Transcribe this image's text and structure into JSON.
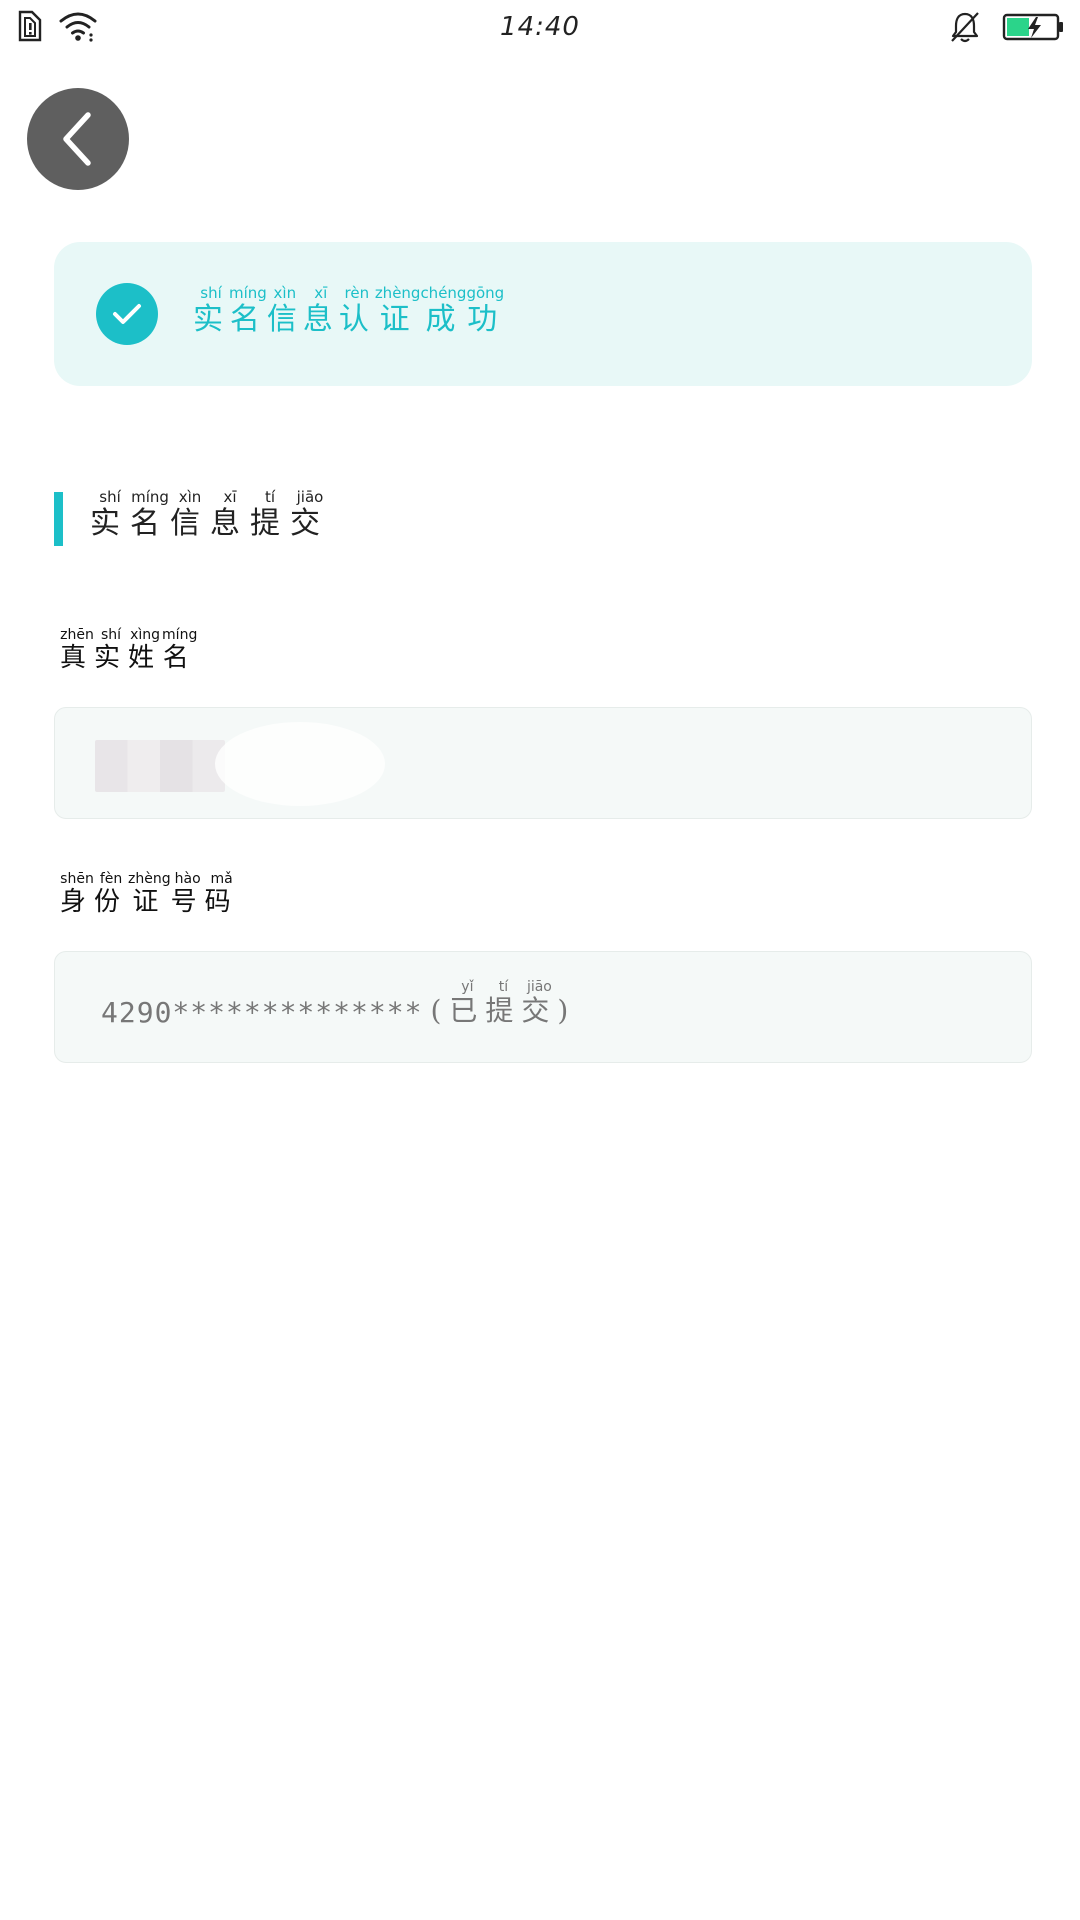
{
  "status_bar": {
    "time": "14:40",
    "icons": [
      "sim-icon",
      "wifi-icon",
      "bell-muted-icon",
      "battery-charging-icon"
    ]
  },
  "back_button": {
    "icon": "chevron-left-icon"
  },
  "banner": {
    "icon": "check-icon",
    "text": [
      {
        "hanzi": "实",
        "pinyin": "shí"
      },
      {
        "hanzi": "名",
        "pinyin": "míng"
      },
      {
        "hanzi": "信",
        "pinyin": "xìn"
      },
      {
        "hanzi": "息",
        "pinyin": "xī"
      },
      {
        "hanzi": "认",
        "pinyin": "rèn"
      },
      {
        "hanzi": "证",
        "pinyin": "zhèng"
      },
      {
        "hanzi": "成",
        "pinyin": "chéng"
      },
      {
        "hanzi": "功",
        "pinyin": "gōng"
      }
    ]
  },
  "section": {
    "title": [
      {
        "hanzi": "实",
        "pinyin": "shí"
      },
      {
        "hanzi": "名",
        "pinyin": "míng"
      },
      {
        "hanzi": "信",
        "pinyin": "xìn"
      },
      {
        "hanzi": "息",
        "pinyin": "xī"
      },
      {
        "hanzi": "提",
        "pinyin": "tí"
      },
      {
        "hanzi": "交",
        "pinyin": "jiāo"
      }
    ]
  },
  "fields": {
    "name_label": [
      {
        "hanzi": "真",
        "pinyin": "zhēn"
      },
      {
        "hanzi": "实",
        "pinyin": "shí"
      },
      {
        "hanzi": "姓",
        "pinyin": "xìng"
      },
      {
        "hanzi": "名",
        "pinyin": "míng"
      }
    ],
    "id_label": [
      {
        "hanzi": "身",
        "pinyin": "shēn"
      },
      {
        "hanzi": "份",
        "pinyin": "fèn"
      },
      {
        "hanzi": "证",
        "pinyin": "zhèng"
      },
      {
        "hanzi": "号",
        "pinyin": "hào"
      },
      {
        "hanzi": "码",
        "pinyin": "mǎ"
      }
    ],
    "id_value": "4290**************",
    "id_note_open": "(",
    "id_note": [
      {
        "hanzi": "已",
        "pinyin": "yǐ"
      },
      {
        "hanzi": "提",
        "pinyin": "tí"
      },
      {
        "hanzi": "交",
        "pinyin": "jiāo"
      }
    ],
    "id_note_close": ")"
  },
  "colors": {
    "accent": "#1cbfc8",
    "banner_bg": "#e8f8f7",
    "field_bg": "#f5f9f8",
    "back_button_bg": "#5f5f5f",
    "battery_fill": "#2bd48a"
  }
}
